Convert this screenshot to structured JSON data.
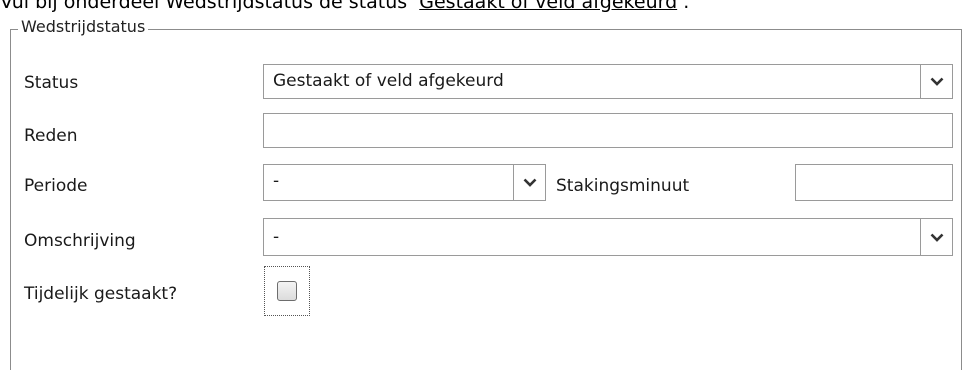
{
  "caption": {
    "prefix": "Vul bij onderdeel Wedstrijdstatus de status ‘",
    "link": "Gestaakt of veld afgekeurd",
    "suffix": "’."
  },
  "group": {
    "legend": "Wedstrijdstatus"
  },
  "fields": {
    "status_label": "Status",
    "status_value": "Gestaakt of veld afgekeurd",
    "reden_label": "Reden",
    "reden_value": "",
    "periode_label": "Periode",
    "periode_value": "-",
    "stakingsminuut_label": "Stakingsminuut",
    "stakingsminuut_value": "",
    "omschrijving_label": "Omschrijving",
    "omschrijving_value": "-",
    "tijdelijk_label": "Tijdelijk gestaakt?",
    "tijdelijk_checked": false
  },
  "icons": {
    "dropdown": "chevron-down-icon"
  }
}
